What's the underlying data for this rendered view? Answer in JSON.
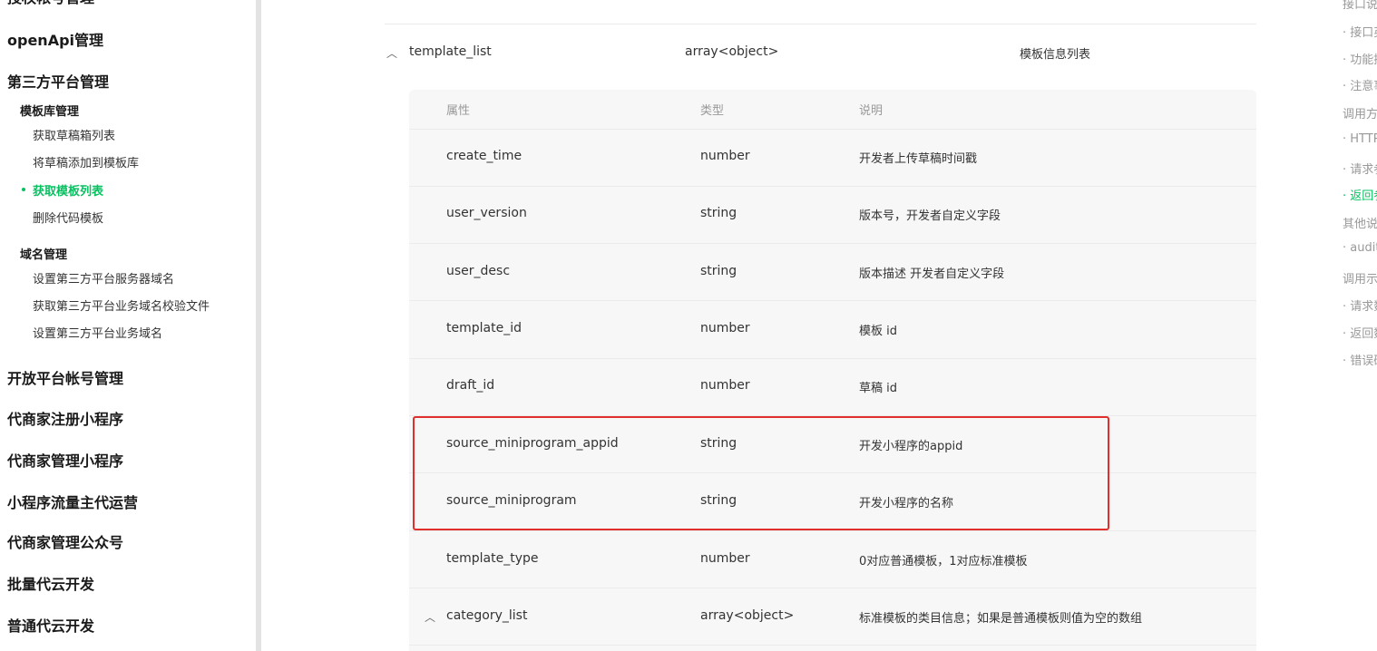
{
  "sidebar": {
    "top_cut": "授权帐号管理",
    "items": [
      {
        "level": 1,
        "label": "openApi管理"
      },
      {
        "level": 1,
        "label": "第三方平台管理"
      },
      {
        "level": 2,
        "label": "模板库管理"
      },
      {
        "level": 3,
        "label": "获取草稿箱列表"
      },
      {
        "level": 3,
        "label": "将草稿添加到模板库"
      },
      {
        "level": 3,
        "label": "获取模板列表",
        "active": true
      },
      {
        "level": 3,
        "label": "删除代码模板"
      },
      {
        "level": 2,
        "label": "域名管理"
      },
      {
        "level": 3,
        "label": "设置第三方平台服务器域名"
      },
      {
        "level": 3,
        "label": "获取第三方平台业务域名校验文件"
      },
      {
        "level": 3,
        "label": "设置第三方平台业务域名"
      },
      {
        "level": 1,
        "label": "开放平台帐号管理"
      },
      {
        "level": 1,
        "label": "代商家注册小程序"
      },
      {
        "level": 1,
        "label": "代商家管理小程序"
      },
      {
        "level": 1,
        "label": "小程序流量主代运营"
      },
      {
        "level": 1,
        "label": "代商家管理公众号"
      },
      {
        "level": 1,
        "label": "批量代云开发"
      },
      {
        "level": 1,
        "label": "普通代云开发"
      }
    ],
    "accent_color": "#07c160"
  },
  "table": {
    "parent_row": {
      "name": "template_list",
      "type": "array<object>",
      "desc": "模板信息列表"
    },
    "headers": {
      "name": "属性",
      "type": "类型",
      "desc": "说明"
    },
    "rows": [
      {
        "name": "create_time",
        "type": "number",
        "desc": "开发者上传草稿时间戳"
      },
      {
        "name": "user_version",
        "type": "string",
        "desc": "版本号，开发者自定义字段"
      },
      {
        "name": "user_desc",
        "type": "string",
        "desc": "版本描述 开发者自定义字段"
      },
      {
        "name": "template_id",
        "type": "number",
        "desc": "模板 id"
      },
      {
        "name": "draft_id",
        "type": "number",
        "desc": "草稿 id"
      },
      {
        "name": "source_miniprogram_appid",
        "type": "string",
        "desc": "开发小程序的appid"
      },
      {
        "name": "source_miniprogram",
        "type": "string",
        "desc": "开发小程序的名称"
      },
      {
        "name": "template_type",
        "type": "number",
        "desc": "0对应普通模板，1对应标准模板"
      },
      {
        "name": "category_list",
        "type": "array<object>",
        "desc": "标准模板的类目信息；如果是普通模板则值为空的数组",
        "expandable": true
      }
    ],
    "highlight_color": "#e0302d"
  },
  "toc": {
    "items": [
      {
        "label": "接口说"
      },
      {
        "label": "· 接口英"
      },
      {
        "label": "· 功能描"
      },
      {
        "label": "· 注意事"
      },
      {
        "label": "调用方"
      },
      {
        "label": "· HTTPS"
      },
      {
        "label": "· 请求参"
      },
      {
        "label": "· 返回参",
        "active": true
      },
      {
        "label": "其他说"
      },
      {
        "label": "· audit"
      },
      {
        "label": "调用示"
      },
      {
        "label": "· 请求数"
      },
      {
        "label": "· 返回数"
      },
      {
        "label": "· 错误码"
      }
    ]
  }
}
